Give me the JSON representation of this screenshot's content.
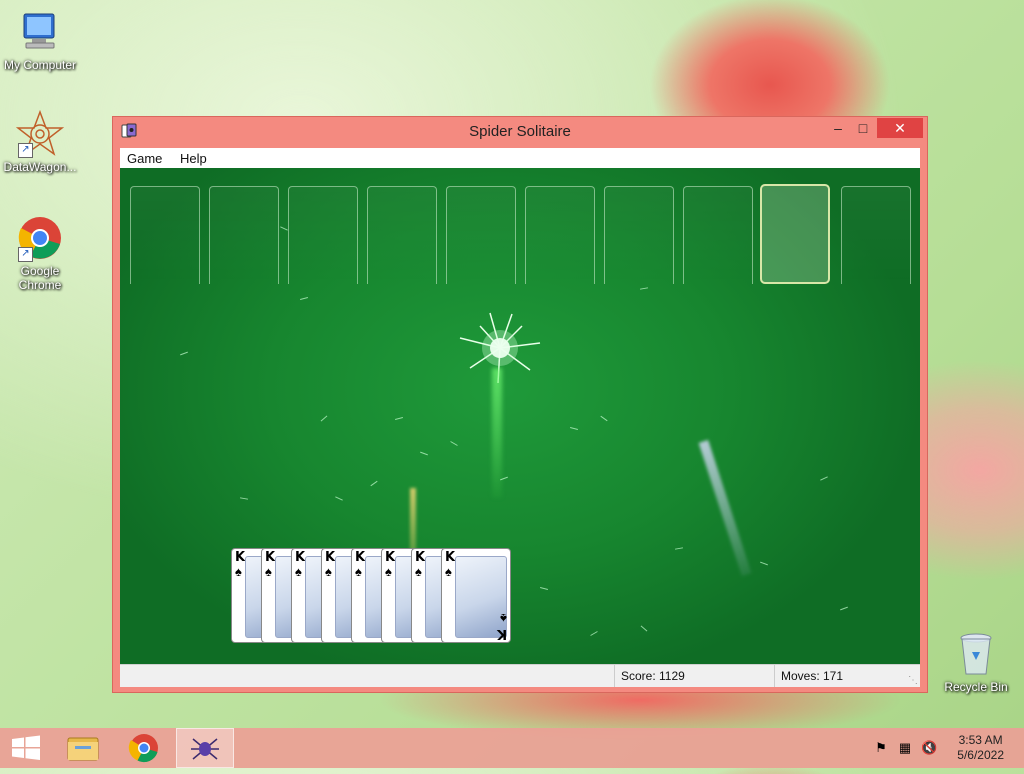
{
  "desktop": {
    "icons": [
      {
        "label": "My Computer"
      },
      {
        "label": "DataWagon..."
      },
      {
        "label": "Google Chrome"
      },
      {
        "label": "Recycle Bin"
      }
    ]
  },
  "window": {
    "title": "Spider Solitaire",
    "controls": {
      "minimize": "–",
      "maximize": "□",
      "close": "✕"
    },
    "menu": [
      "Game",
      "Help"
    ],
    "status": {
      "score": "Score: 1129",
      "moves": "Moves:  171"
    }
  },
  "game": {
    "foundation_slots": 10,
    "selected_slot_index": 8,
    "completed_run": {
      "rank": "K",
      "suit": "♠",
      "count": 8
    }
  },
  "taskbar": {
    "start": "windows-start",
    "pinned": [
      "file-explorer",
      "google-chrome",
      "spider-solitaire"
    ],
    "clock_time": "3:53 AM",
    "clock_date": "5/6/2022"
  },
  "colors": {
    "window_frame": "#f48a80",
    "felt": "#17862f",
    "close_button": "#e04343"
  }
}
